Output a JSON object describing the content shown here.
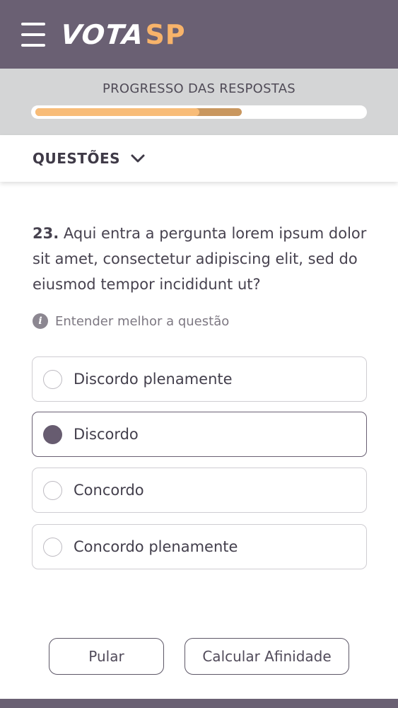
{
  "header": {
    "logo_part1": "VOTA",
    "logo_part2": "SP",
    "menu_icon": "hamburger-menu-icon",
    "colors": {
      "bar": "#6a6073",
      "accent": "#f7b36a"
    }
  },
  "progress": {
    "title": "PROGRESSO DAS RESPOSTAS",
    "answered_fraction": 0.5,
    "total_fraction": 0.63,
    "colors": {
      "answered": "#f8bc78",
      "total": "#c9975f"
    }
  },
  "questoes": {
    "label": "QUESTÕES",
    "icon": "chevron-down-icon"
  },
  "question": {
    "number": "23.",
    "text": " Aqui entra a pergunta lorem ipsum dolor sit amet, consectetur adipiscing elit, sed do eiusmod tempor incididunt ut?"
  },
  "help": {
    "icon": "info-icon",
    "icon_glyph": "i",
    "text": "Entender melhor a questão"
  },
  "options": [
    {
      "label": "Discordo plenamente",
      "selected": false
    },
    {
      "label": "Discordo",
      "selected": true
    },
    {
      "label": "Concordo",
      "selected": false
    },
    {
      "label": "Concordo plenamente",
      "selected": false
    }
  ],
  "actions": {
    "skip_label": "Pular",
    "calculate_label": "Calcular Afinidade"
  }
}
